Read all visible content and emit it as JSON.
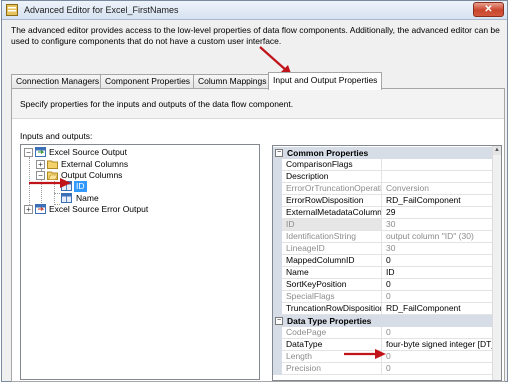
{
  "window": {
    "title": "Advanced Editor for Excel_FirstNames",
    "close_glyph": "✕"
  },
  "description": "The advanced editor provides access to the low-level properties of data flow components. Additionally, the advanced editor can be used to configure components that do not have a custom user interface.",
  "tabs": [
    {
      "label": "Connection Managers",
      "active": false
    },
    {
      "label": "Component Properties",
      "active": false
    },
    {
      "label": "Column Mappings",
      "active": false
    },
    {
      "label": "Input and Output Properties",
      "active": true
    }
  ],
  "panel": {
    "description": "Specify properties for the inputs and outputs of the data flow component.",
    "io_label": "Inputs and outputs:"
  },
  "tree": {
    "nodes": [
      {
        "label": "Excel Source Output",
        "icon": "output-icon",
        "expander": "−"
      },
      {
        "label": "External Columns",
        "icon": "folder-icon",
        "expander": "+"
      },
      {
        "label": "Output Columns",
        "icon": "folder-icon",
        "expander": "−"
      },
      {
        "label": "ID",
        "icon": "column-icon",
        "selected": true
      },
      {
        "label": "Name",
        "icon": "column-icon"
      },
      {
        "label": "Excel Source Error Output",
        "icon": "output-icon",
        "expander": "+"
      }
    ]
  },
  "properties": {
    "common_header": "Common Properties",
    "common": [
      {
        "name": "ComparisonFlags",
        "value": "",
        "readonly": false
      },
      {
        "name": "Description",
        "value": "",
        "readonly": false
      },
      {
        "name": "ErrorOrTruncationOperation",
        "value": "Conversion",
        "readonly": true
      },
      {
        "name": "ErrorRowDisposition",
        "value": "RD_FailComponent",
        "readonly": false
      },
      {
        "name": "ExternalMetadataColumnID",
        "value": "29",
        "readonly": false
      },
      {
        "name": "ID",
        "value": "30",
        "readonly": true
      },
      {
        "name": "IdentificationString",
        "value": "output column \"ID\" (30)",
        "readonly": true
      },
      {
        "name": "LineageID",
        "value": "30",
        "readonly": true
      },
      {
        "name": "MappedColumnID",
        "value": "0",
        "readonly": false
      },
      {
        "name": "Name",
        "value": "ID",
        "readonly": false
      },
      {
        "name": "SortKeyPosition",
        "value": "0",
        "readonly": false
      },
      {
        "name": "SpecialFlags",
        "value": "0",
        "readonly": true
      },
      {
        "name": "TruncationRowDisposition",
        "value": "RD_FailComponent",
        "readonly": false
      }
    ],
    "datatype_header": "Data Type Properties",
    "datatype": [
      {
        "name": "CodePage",
        "value": "0",
        "readonly": true
      },
      {
        "name": "DataType",
        "value": "four-byte signed integer [DT_I4]",
        "readonly": false
      },
      {
        "name": "Length",
        "value": "0",
        "readonly": true
      },
      {
        "name": "Precision",
        "value": "0",
        "readonly": true
      }
    ]
  },
  "colors": {
    "arrow": "#c0141a",
    "selection": "#3399ff",
    "category_bg": "#d7dde6"
  }
}
